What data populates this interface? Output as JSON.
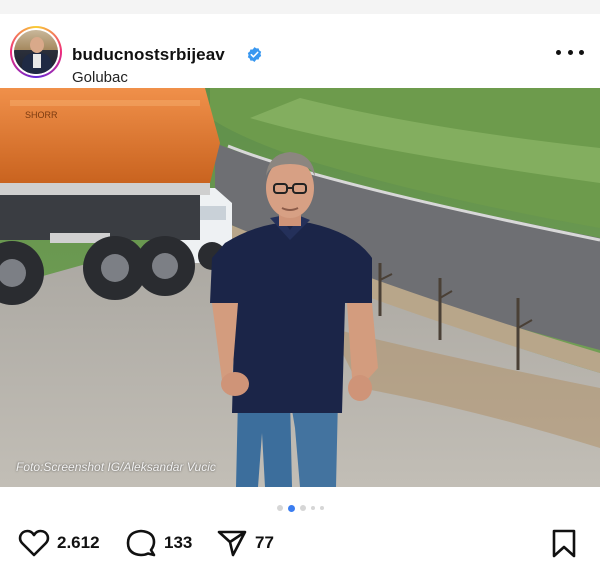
{
  "post": {
    "username": "buducnostsrbijeav",
    "location": "Golubac",
    "photo_credit": "Foto:Screenshot IG/Aleksandar Vucic",
    "truck_brand": "SHORR"
  },
  "carousel": {
    "total_slides": 5,
    "active_index": 1
  },
  "actions": {
    "likes": "2.612",
    "comments": "133",
    "shares": "77"
  },
  "icons": {
    "verified": "verified-badge-icon",
    "more": "more-options-icon",
    "like": "heart-icon",
    "comment": "comment-bubble-icon",
    "share": "send-paper-plane-icon",
    "save": "bookmark-icon"
  },
  "colors": {
    "verified_blue": "#3897f0",
    "carousel_active": "#3b7df0",
    "truck_orange": "#e07a2e"
  }
}
